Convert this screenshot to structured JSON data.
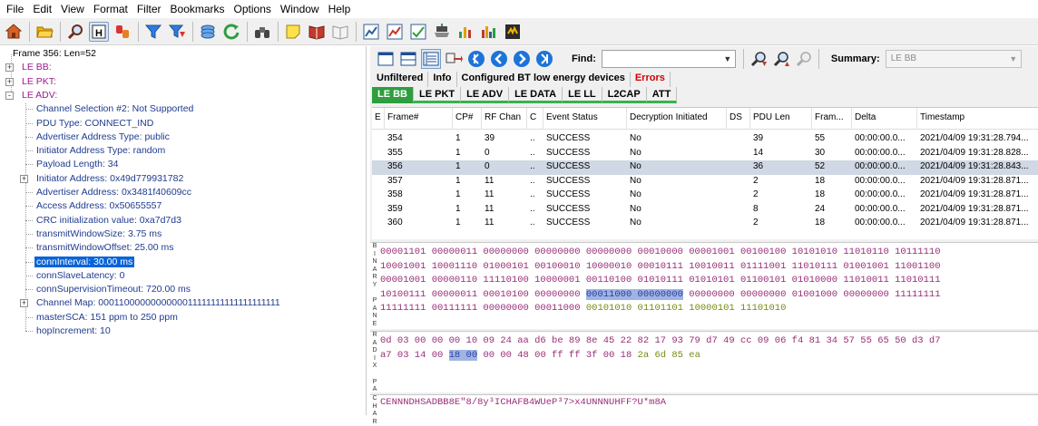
{
  "menu": [
    "File",
    "Edit",
    "View",
    "Format",
    "Filter",
    "Bookmarks",
    "Options",
    "Window",
    "Help"
  ],
  "toolbar_icons": [
    "home-icon",
    "open-folder-icon",
    "find-icon",
    "hex-view-icon",
    "trigger-icon",
    "filter-icon",
    "filter-apply-icon",
    "layers-icon",
    "refresh-icon",
    "binoculars-icon",
    "note-icon",
    "book-open-icon",
    "book-icon",
    "chart-line-icon",
    "chart-line-red-icon",
    "chart-check-icon",
    "device-icon",
    "bar-chart-icon",
    "multi-bar-icon",
    "energy-icon"
  ],
  "tree": {
    "items": [
      {
        "label": "Frame 356:  Len=52",
        "level": 0
      },
      {
        "label": "LE BB:",
        "level": 1,
        "expander": "+"
      },
      {
        "label": "LE PKT:",
        "level": 1,
        "expander": "+"
      },
      {
        "label": "LE ADV:",
        "level": 1,
        "expander": "-"
      },
      {
        "label": "Channel Selection #2: Not Supported",
        "level": 2
      },
      {
        "label": "PDU Type: CONNECT_IND",
        "level": 2
      },
      {
        "label": "Advertiser Address Type: public",
        "level": 2
      },
      {
        "label": "Initiator Address Type: random",
        "level": 2
      },
      {
        "label": "Payload Length: 34",
        "level": 2
      },
      {
        "label": "Initiator Address: 0x49d779931782",
        "level": 2,
        "expander": "+"
      },
      {
        "label": "Advertiser Address: 0x3481f40609cc",
        "level": 2
      },
      {
        "label": "Access Address: 0x50655557",
        "level": 2
      },
      {
        "label": "CRC initialization value: 0xa7d7d3",
        "level": 2
      },
      {
        "label": "transmitWindowSize: 3.75  ms",
        "level": 2
      },
      {
        "label": "transmitWindowOffset: 25.00  ms",
        "level": 2
      },
      {
        "label": "connInterval: 30.00  ms",
        "level": 2,
        "selected": true
      },
      {
        "label": "connSlaveLatency: 0",
        "level": 2
      },
      {
        "label": "connSupervisionTimeout: 720.00  ms",
        "level": 2
      },
      {
        "label": "Channel Map: 0001100000000000011111111111111111111",
        "level": 2,
        "expander": "+"
      },
      {
        "label": "masterSCA: 151 ppm to 250 ppm",
        "level": 2
      },
      {
        "label": "hopIncrement: 10",
        "level": 2
      }
    ]
  },
  "right_toolbar": {
    "find_label": "Find:",
    "find_value": "",
    "summary_label": "Summary:",
    "summary_value": "LE BB"
  },
  "tabs_row1": [
    "Unfiltered",
    "Info",
    "Configured BT low energy devices",
    "Errors"
  ],
  "tabs_row2": [
    "LE BB",
    "LE PKT",
    "LE ADV",
    "LE DATA",
    "LE LL",
    "L2CAP",
    "ATT"
  ],
  "packet_list": {
    "columns": [
      "E",
      "Frame#",
      "CP#",
      "RF Chan",
      "C",
      "Event Status",
      "Decryption Initiated",
      "DS",
      "PDU Len",
      "Fram...",
      "Delta",
      "Timestamp"
    ],
    "rows": [
      [
        "",
        "354",
        "1",
        "39",
        "..",
        "SUCCESS",
        "No",
        "",
        "39",
        "55",
        "00:00:00.0...",
        "2021/04/09 19:31:28.794..."
      ],
      [
        "",
        "355",
        "1",
        "0",
        "..",
        "SUCCESS",
        "No",
        "",
        "14",
        "30",
        "00:00:00.0...",
        "2021/04/09 19:31:28.828..."
      ],
      [
        "",
        "356",
        "1",
        "0",
        "..",
        "SUCCESS",
        "No",
        "",
        "36",
        "52",
        "00:00:00.0...",
        "2021/04/09 19:31:28.843..."
      ],
      [
        "",
        "357",
        "1",
        "11",
        "..",
        "SUCCESS",
        "No",
        "",
        "2",
        "18",
        "00:00:00.0...",
        "2021/04/09 19:31:28.871..."
      ],
      [
        "",
        "358",
        "1",
        "11",
        "..",
        "SUCCESS",
        "No",
        "",
        "2",
        "18",
        "00:00:00.0...",
        "2021/04/09 19:31:28.871..."
      ],
      [
        "",
        "359",
        "1",
        "11",
        "..",
        "SUCCESS",
        "No",
        "",
        "8",
        "24",
        "00:00:00.0...",
        "2021/04/09 19:31:28.871..."
      ],
      [
        "",
        "360",
        "1",
        "11",
        "..",
        "SUCCESS",
        "No",
        "",
        "2",
        "18",
        "00:00:00.0...",
        "2021/04/09 19:31:28.871..."
      ]
    ],
    "selected_row": 2
  },
  "binary_pane": {
    "label": "BINARY PANE",
    "lines": [
      [
        [
          "00001101 00000011 00000000 00000000 00000000 00010000 00001001 00100100 10101010 11010110 10111110",
          "purple"
        ]
      ],
      [
        [
          "10001001 10001110 01000101 00100010 10000010 00010111 10010011 01111001 11010111 01001001 11001100",
          "purple"
        ]
      ],
      [
        [
          "00001001 00000110 11110100 10000001 00110100 01010111 01010101 01100101 01010000 11010011 11010111",
          "purple"
        ]
      ],
      [
        [
          "10100111 00000011 00010100 00000000 ",
          "purple"
        ],
        [
          "00011000 00000000",
          "hl"
        ],
        [
          " 00000000 00000000 01001000 00000000 11111111",
          "purple"
        ]
      ],
      [
        [
          "11111111 00111111 00000000 00011000 ",
          "purple"
        ],
        [
          "00101010 01101101 10000101 11101010",
          "olive"
        ]
      ]
    ]
  },
  "radix_pane": {
    "label": "RADIX PANE",
    "lines": [
      [
        [
          "0d 03 00 00 00 10 09 24 aa d6 be 89 8e 45 22 82 17 93 79 d7 49 cc 09 06 f4 81 34 57 55 65 50 d3 d7",
          "purple"
        ]
      ],
      [
        [
          "a7 03 14 00 ",
          "purple"
        ],
        [
          "18 00",
          "hl"
        ],
        [
          " 00 00 48 00 ff ff 3f 00 18 ",
          "purple"
        ],
        [
          "2a 6d 85 ea",
          "olive"
        ]
      ]
    ]
  },
  "char_pane": {
    "label": "CHAR",
    "text": "CENNNDHSADBB8E\"8/8y³ICHAFB4WUeP³7>x4UNNNUHFF?U*m8A"
  }
}
